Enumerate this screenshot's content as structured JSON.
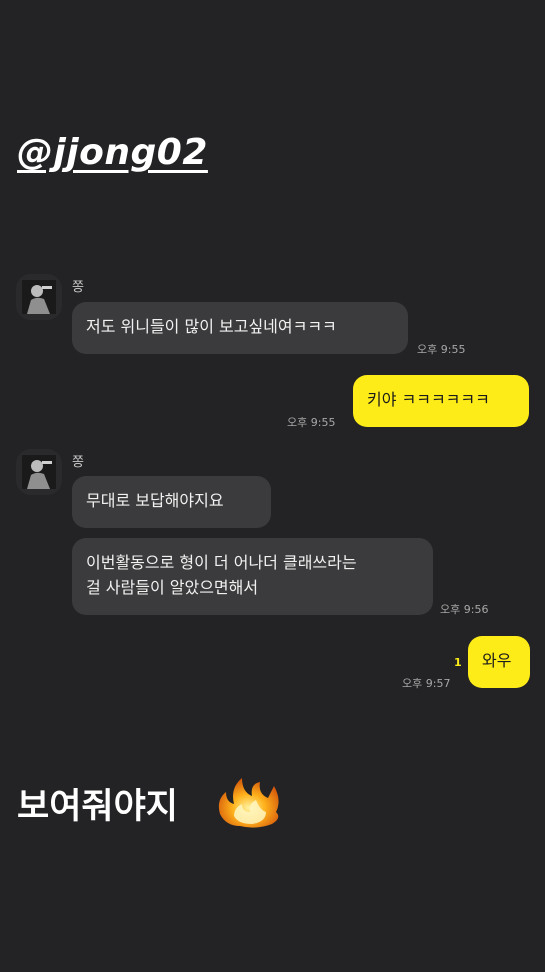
{
  "story": {
    "handle": "@jjong02",
    "caption": "보여줘야지"
  },
  "chat": {
    "sender_name": "쫑",
    "messages": [
      {
        "from": "sender",
        "text": "저도 위니들이 많이 보고싶네여ㅋㅋㅋ",
        "time": "오후 9:55"
      },
      {
        "from": "me",
        "text": "키야 ㅋㅋㅋㅋㅋㅋ",
        "time": "오후 9:55"
      },
      {
        "from": "sender",
        "text": "무대로 보답해야지요"
      },
      {
        "from": "sender",
        "lines": [
          "이번활동으로 형이 더 어나더 클래쓰라는",
          "걸 사람들이 알았으면해서"
        ],
        "time": "오후 9:56"
      },
      {
        "from": "me",
        "text": "와우",
        "time": "오후 9:57",
        "unread": "1"
      }
    ]
  },
  "colors": {
    "background": "#232325",
    "incoming_bubble": "#3b3b3d",
    "outgoing_bubble": "#fdec18"
  },
  "icons": {
    "sticker": "fire-icon",
    "avatar": "profile-photo"
  }
}
